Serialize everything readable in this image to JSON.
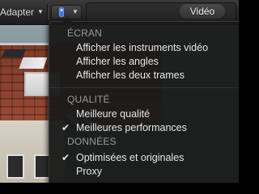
{
  "toolbar": {
    "adapter_label": "Adapter",
    "video_label": "Vidéo"
  },
  "menu": {
    "sections": [
      {
        "title": "ÉCRAN",
        "items": [
          {
            "label": "Afficher les instruments vidéo",
            "checked": false
          },
          {
            "label": "Afficher les angles",
            "checked": false
          },
          {
            "label": "Afficher les deux trames",
            "checked": false
          }
        ]
      },
      {
        "title": "QUALITÉ",
        "items": [
          {
            "label": "Meilleure qualité",
            "checked": false
          },
          {
            "label": "Meilleures performances",
            "checked": true
          }
        ]
      },
      {
        "title": "DONNÉES",
        "items": [
          {
            "label": "Optimisées et originales",
            "checked": true
          },
          {
            "label": "Proxy",
            "checked": false
          }
        ]
      }
    ],
    "check_glyph": "✔"
  },
  "colors": {
    "accent_blue": "#2f7bff",
    "menu_bg": "#1a1a1a",
    "section_text": "#9a9a9a",
    "item_text": "#e6e6e6"
  },
  "icons": {
    "view_button_icon": "view-options-icon",
    "dropdown_arrow": "chevron-down-icon"
  }
}
